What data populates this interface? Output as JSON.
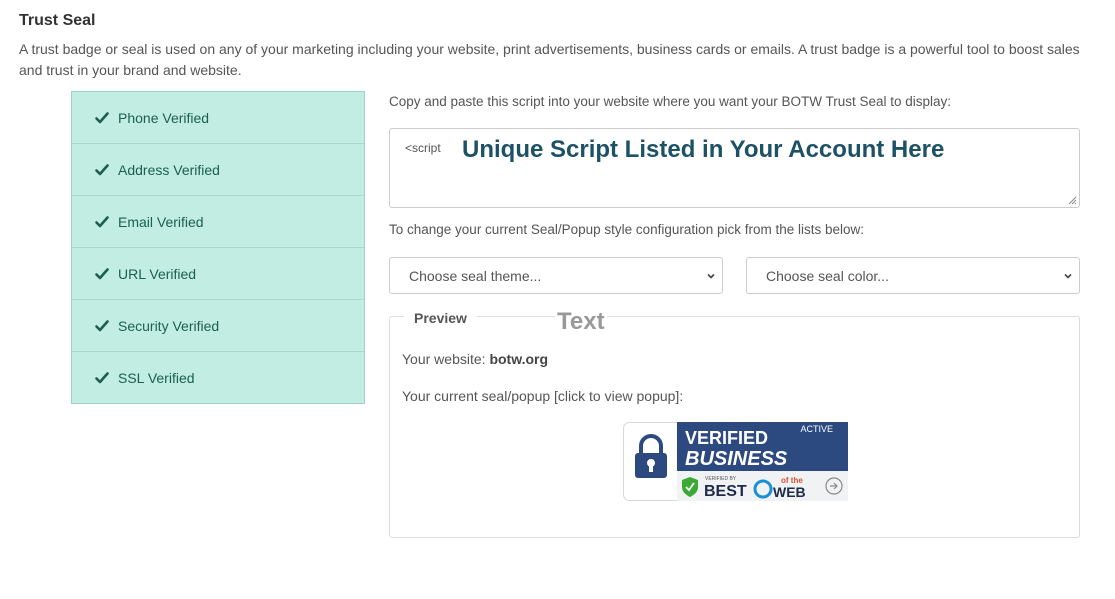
{
  "section": {
    "title": "Trust Seal",
    "description": "A trust badge or seal is used on any of your marketing including your website, print advertisements, business cards or emails. A trust badge is a powerful tool to boost sales and trust in your brand and website."
  },
  "verifications": [
    {
      "label": "Phone Verified"
    },
    {
      "label": "Address Verified"
    },
    {
      "label": "Email Verified"
    },
    {
      "label": "URL Verified"
    },
    {
      "label": "Security Verified"
    },
    {
      "label": "SSL Verified"
    }
  ],
  "script": {
    "instruction": "Copy and paste this script into your website where you want your BOTW Trust Seal to display:",
    "prefix": "<script",
    "note": "Unique Script Listed in Your Account Here"
  },
  "config": {
    "instruction": "To change your current Seal/Popup style configuration pick from the lists below:",
    "theme_placeholder": "Choose seal theme...",
    "color_placeholder": "Choose seal color..."
  },
  "preview": {
    "legend": "Preview",
    "overlay": "Text",
    "website_label": "Your website:",
    "website_value": "botw.org",
    "seal_label": "Your current seal/popup [click to view popup]:"
  },
  "seal": {
    "status": "ACTIVE",
    "line1": "VERIFIED",
    "line2": "BUSINESS",
    "verified_by": "VERIFIED BY",
    "brand_best": "BEST",
    "brand_of_the": "of the",
    "brand_web": "WEB"
  },
  "colors": {
    "panel_bg": "#c1ede3",
    "check": "#1d5e50",
    "seal_navy": "#2c4a80",
    "seal_lock": "#2c4a80"
  }
}
